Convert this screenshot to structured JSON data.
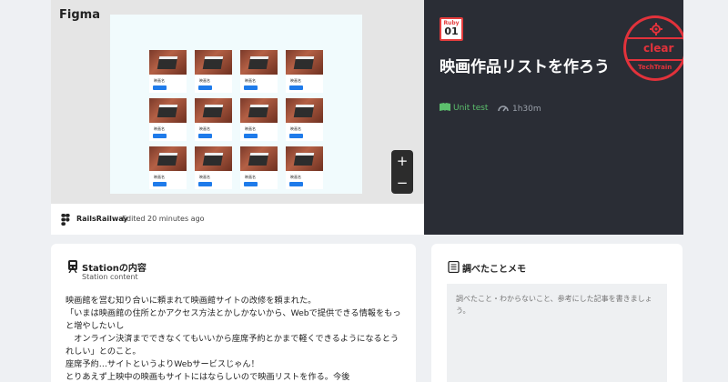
{
  "figma": {
    "logo": "Figma",
    "frame_cards": [
      {
        "title": "映画名"
      },
      {
        "title": "映画名"
      },
      {
        "title": "映画名"
      },
      {
        "title": "映画名"
      },
      {
        "title": "映画名"
      },
      {
        "title": "映画名"
      },
      {
        "title": "映画名"
      },
      {
        "title": "映画名"
      },
      {
        "title": "映画名"
      },
      {
        "title": "映画名"
      },
      {
        "title": "映画名"
      },
      {
        "title": "映画名"
      }
    ],
    "zoom_in": "+",
    "zoom_out": "−",
    "footer": {
      "project": "RailsRailway",
      "edited": "Edited 20 minutes ago"
    }
  },
  "hero": {
    "badge_lang": "Ruby",
    "badge_num": "01",
    "title": "映画作品リストを作ろう",
    "meta_test": "Unit test",
    "meta_time": "1h30m",
    "stamp_text": "clear",
    "stamp_sub": "TechTrain",
    "colors": {
      "dark_bg": "#2a2d35",
      "stamp": "#e2323b",
      "test": "#5cc06d"
    }
  },
  "station": {
    "title": "Stationの内容",
    "subtitle": "Station content",
    "paragraphs": [
      "映画館を営む知り合いに頼まれて映画館サイトの改修を頼まれた。",
      "「いまは映画館の住所とかアクセス方法とかしかないから、Webで提供できる情報をもっと増やしたいし",
      "　オンライン決済までできなくてもいいから座席予約とかまで軽くできるようになるとうれしい」とのこと。",
      "座席予約…サイトというよりWebサービスじゃん！",
      "とりあえず上映中の映画もサイトにはならしいので映画リストを作る。今後"
    ]
  },
  "memo": {
    "title": "調べたことメモ",
    "placeholder": "調べたこと・わからないこと、参考にした記事を書きましょう。"
  }
}
